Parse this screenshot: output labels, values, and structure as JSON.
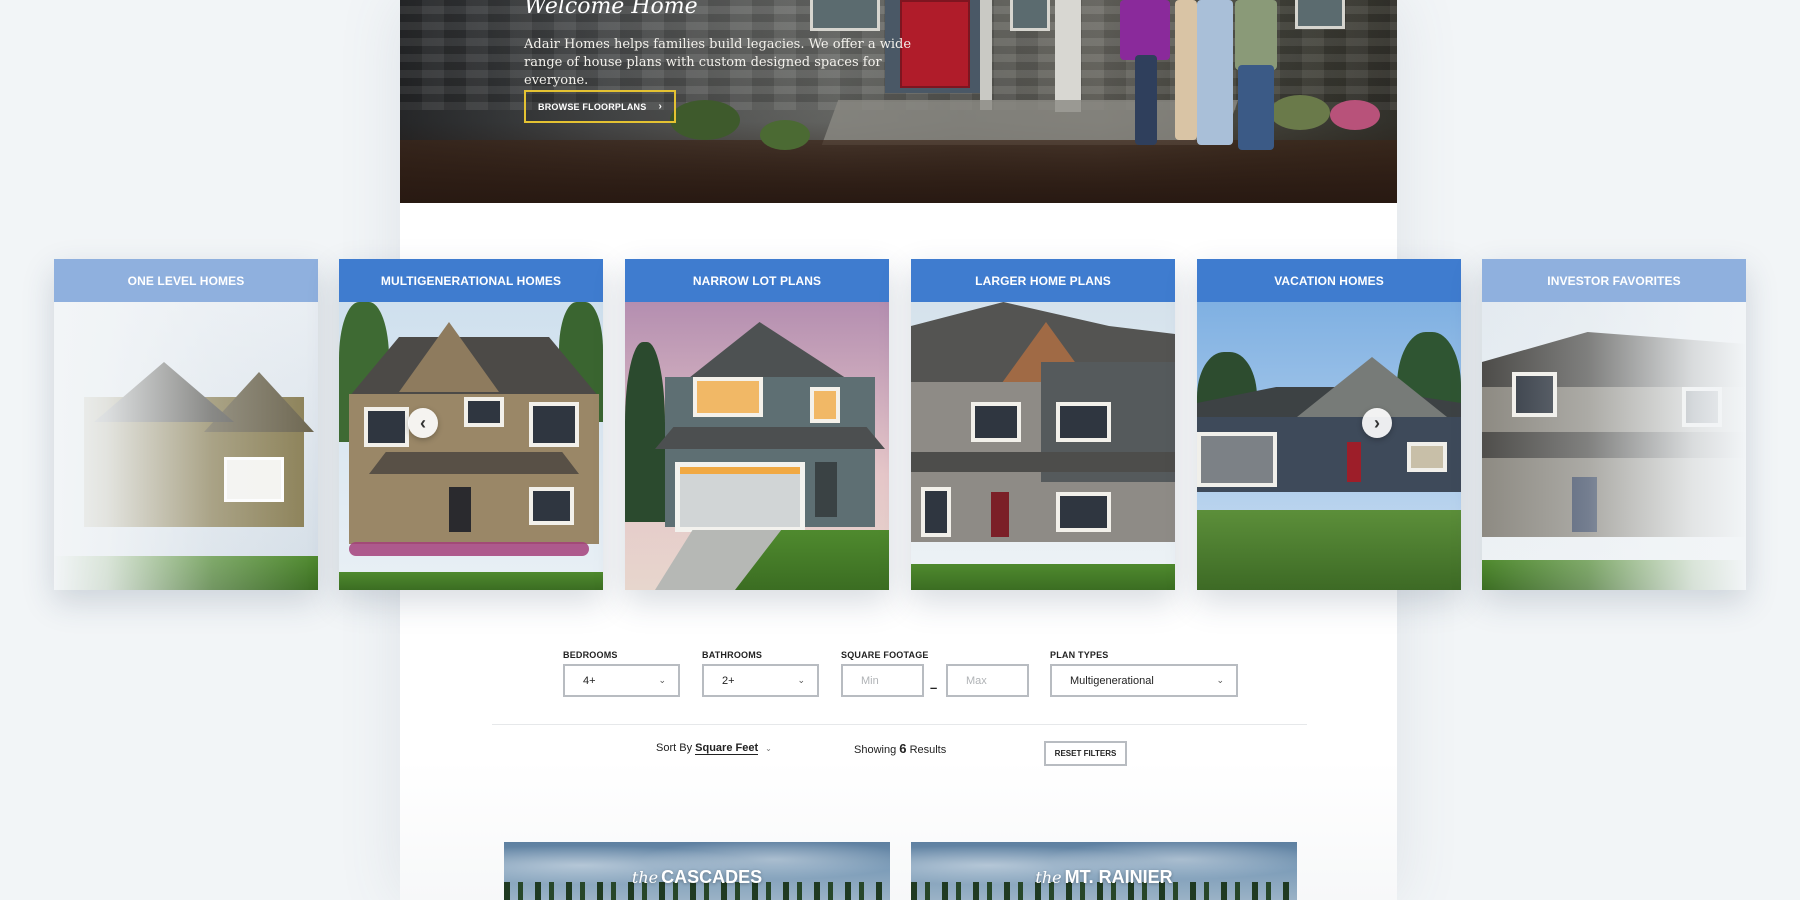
{
  "hero": {
    "title": "Welcome Home",
    "description": "Adair Homes helps families build legacies. We offer a wide range of house plans with custom designed spaces for everyone.",
    "button_label": "BROWSE FLOORPLANS"
  },
  "carousel": {
    "cards": [
      {
        "label": "ONE LEVEL HOMES"
      },
      {
        "label": "MULTIGENERATIONAL HOMES"
      },
      {
        "label": "NARROW LOT PLANS"
      },
      {
        "label": "LARGER HOME PLANS"
      },
      {
        "label": "VACATION HOMES"
      },
      {
        "label": "INVESTOR FAVORITES"
      }
    ]
  },
  "filters": {
    "bedrooms": {
      "label": "BEDROOMS",
      "value": "4+"
    },
    "bathrooms": {
      "label": "BATHROOMS",
      "value": "2+"
    },
    "square_footage": {
      "label": "SQUARE FOOTAGE",
      "min_placeholder": "Min",
      "max_placeholder": "Max",
      "separator": "–"
    },
    "plan_types": {
      "label": "PLAN TYPES",
      "value": "Multigenerational"
    }
  },
  "results_bar": {
    "sort_prefix": "Sort By",
    "sort_value": "Square Feet",
    "showing_prefix": "Showing",
    "count": "6",
    "showing_suffix": "Results",
    "reset_label": "RESET FILTERS"
  },
  "results": [
    {
      "prefix": "the",
      "name": "CASCADES"
    },
    {
      "prefix": "the",
      "name": "MT. RAINIER"
    }
  ],
  "colors": {
    "accent_blue": "#3f7ccf",
    "button_border_yellow": "#e4c232"
  }
}
